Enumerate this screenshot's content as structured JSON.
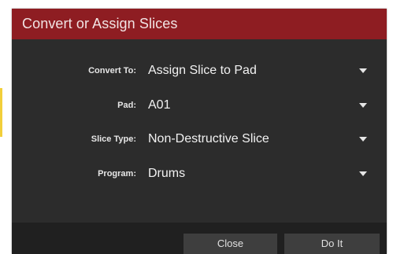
{
  "dialog": {
    "title": "Convert or Assign Slices"
  },
  "fields": [
    {
      "label": "Convert To:",
      "value": "Assign Slice to Pad",
      "icon": "chevron-down-icon"
    },
    {
      "label": "Pad:",
      "value": "A01",
      "icon": "chevron-down-icon"
    },
    {
      "label": "Slice Type:",
      "value": "Non-Destructive Slice",
      "icon": "chevron-down-icon"
    },
    {
      "label": "Program:",
      "value": "Drums",
      "icon": "chevron-down-icon"
    }
  ],
  "footer": {
    "close_label": "Close",
    "doit_label": "Do It"
  },
  "colors": {
    "titlebar": "#8e1d22",
    "body": "#2c2c2c",
    "footer": "#202020",
    "button": "#3e3e3e",
    "accent": "#f2cf3a"
  }
}
